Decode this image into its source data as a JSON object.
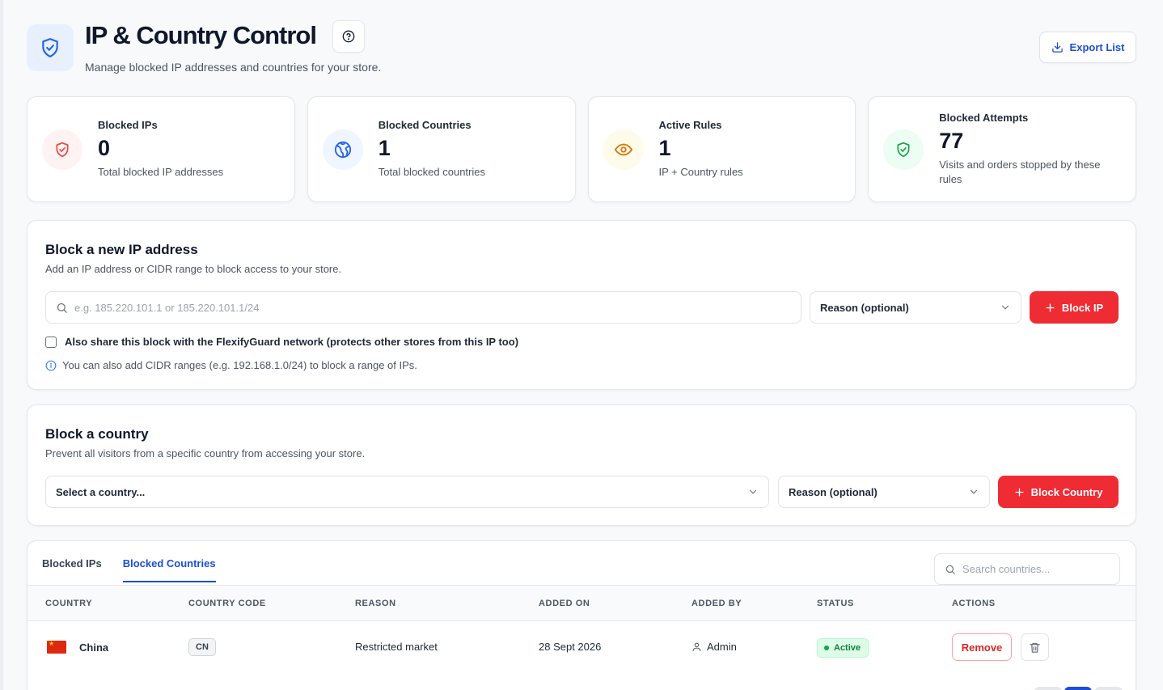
{
  "header": {
    "title": "IP & Country Control",
    "subtitle": "Manage blocked IP addresses and countries for your store.",
    "export_label": "Export List"
  },
  "stats": [
    {
      "label": "Blocked IPs",
      "value": "0",
      "desc": "Total blocked IP addresses",
      "icon": "shield-alert-icon",
      "color": "#ef4444"
    },
    {
      "label": "Blocked Countries",
      "value": "1",
      "desc": "Total blocked countries",
      "icon": "globe-icon",
      "color": "#2563eb"
    },
    {
      "label": "Active Rules",
      "value": "1",
      "desc": "IP + Country rules",
      "icon": "eye-icon",
      "color": "#d97706"
    },
    {
      "label": "Blocked Attempts",
      "value": "77",
      "desc": "Visits and orders stopped by these rules",
      "icon": "shield-check-icon",
      "color": "#16a34a"
    }
  ],
  "block_ip": {
    "title": "Block a new IP address",
    "subtitle": "Add an IP address or CIDR range to block access to your store.",
    "ip_placeholder": "e.g. 185.220.101.1 or 185.220.101.1/24",
    "reason_label": "Reason (optional)",
    "button_label": "Block IP",
    "share_label": "Also share this block with the FlexifyGuard network (protects other stores from this IP too)",
    "info_text": "You can also add CIDR ranges (e.g. 192.168.1.0/24) to block a range of IPs."
  },
  "block_country": {
    "title": "Block a country",
    "subtitle": "Prevent all visitors from a specific country from accessing your store.",
    "country_label": "Select a country...",
    "reason_label": "Reason (optional)",
    "button_label": "Block Country"
  },
  "table": {
    "tabs": [
      "Blocked IPs",
      "Blocked Countries"
    ],
    "active_tab": "Blocked Countries",
    "search_placeholder": "Search countries...",
    "columns": [
      "COUNTRY",
      "COUNTRY CODE",
      "REASON",
      "ADDED ON",
      "ADDED BY",
      "STATUS",
      "ACTIONS"
    ],
    "rows": [
      {
        "country": "China",
        "code": "CN",
        "reason": "Restricted market",
        "added_on": "28 Sept 2026",
        "added_by": "Admin",
        "status": "Active",
        "remove_label": "Remove"
      }
    ]
  },
  "colors": {
    "accent": "#1d4ed8",
    "danger": "#ef2b34",
    "success": "#15803d"
  }
}
